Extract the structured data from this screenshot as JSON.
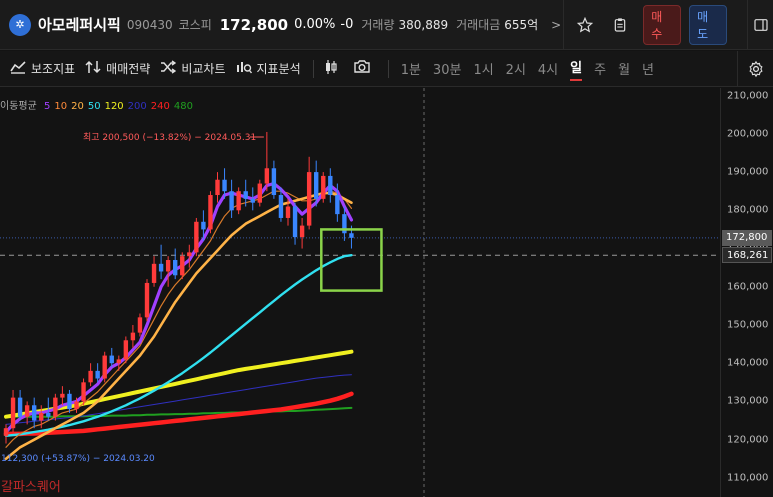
{
  "header": {
    "logo_glyph": "✲",
    "name": "아모레퍼시픽",
    "code": "090430",
    "market": "코스피",
    "price": "172,800",
    "change_pct": "0.00%",
    "change_abs": "-0",
    "volume_label": "거래량",
    "volume": "380,889",
    "amount_label": "거래대금",
    "amount": "655억",
    "nav_arrow": ">",
    "buy_label": "매수",
    "sell_label": "매도"
  },
  "toolbar": {
    "indicators_label": "보조지표",
    "strategy_label": "매매전략",
    "compare_label": "비교차트",
    "analysis_label": "지표분석",
    "periods": [
      "1분",
      "30분",
      "1시",
      "2시",
      "4시",
      "일",
      "주",
      "월",
      "년"
    ],
    "active_period": "일"
  },
  "legend": {
    "title": "이동평균",
    "items": [
      {
        "label": "5",
        "color": "#a040ff"
      },
      {
        "label": "10",
        "color": "#ff8a3a"
      },
      {
        "label": "20",
        "color": "#ffb347"
      },
      {
        "label": "50",
        "color": "#30e0f0"
      },
      {
        "label": "120",
        "color": "#f0f020"
      },
      {
        "label": "200",
        "color": "#3030c0"
      },
      {
        "label": "240",
        "color": "#ff2020"
      },
      {
        "label": "480",
        "color": "#20a020"
      }
    ]
  },
  "annotations": {
    "high": "최고 200,500 (−13.82%) − 2024.05.31",
    "low": "112,300 (+53.87%) − 2024.03.20"
  },
  "watermark": "갈파스퀘어",
  "axis": {
    "ticks": [
      "210,000",
      "200,000",
      "190,000",
      "180,000",
      "170,000",
      "160,000",
      "150,000",
      "140,000",
      "130,000",
      "120,000",
      "110,000"
    ],
    "current_price_tag": "172,800",
    "ma_price_tag": "168,261"
  },
  "colors": {
    "up": "#ff3b3b",
    "down": "#3a86ff",
    "highlight_box": "#8bd44a",
    "ma5": "#a040ff",
    "ma20": "#ffb347",
    "ma50": "#30e0f0",
    "ma120": "#f0f020",
    "ma200": "#3030c0",
    "ma240": "#ff2020",
    "ma480": "#20a020"
  },
  "chart_data": {
    "type": "candlestick",
    "ylim": [
      105000,
      212000
    ],
    "candles": [
      {
        "o": 121000,
        "h": 124000,
        "l": 119000,
        "c": 123000
      },
      {
        "o": 123000,
        "h": 133000,
        "l": 122000,
        "c": 131000
      },
      {
        "o": 131000,
        "h": 133000,
        "l": 125000,
        "c": 126000
      },
      {
        "o": 126000,
        "h": 130000,
        "l": 124000,
        "c": 129000
      },
      {
        "o": 129000,
        "h": 131000,
        "l": 123000,
        "c": 125000
      },
      {
        "o": 125000,
        "h": 129000,
        "l": 123000,
        "c": 127000
      },
      {
        "o": 127000,
        "h": 131000,
        "l": 125000,
        "c": 126000
      },
      {
        "o": 126000,
        "h": 132000,
        "l": 125000,
        "c": 131000
      },
      {
        "o": 131000,
        "h": 134000,
        "l": 129000,
        "c": 132000
      },
      {
        "o": 132000,
        "h": 133000,
        "l": 127000,
        "c": 128000
      },
      {
        "o": 128000,
        "h": 131000,
        "l": 127000,
        "c": 130000
      },
      {
        "o": 130000,
        "h": 136000,
        "l": 129000,
        "c": 135000
      },
      {
        "o": 135000,
        "h": 140000,
        "l": 134000,
        "c": 138000
      },
      {
        "o": 138000,
        "h": 140000,
        "l": 135000,
        "c": 136000
      },
      {
        "o": 136000,
        "h": 143000,
        "l": 135000,
        "c": 142000
      },
      {
        "o": 142000,
        "h": 144000,
        "l": 139000,
        "c": 140000
      },
      {
        "o": 140000,
        "h": 142000,
        "l": 138000,
        "c": 141000
      },
      {
        "o": 141000,
        "h": 147000,
        "l": 140000,
        "c": 146000
      },
      {
        "o": 146000,
        "h": 150000,
        "l": 144000,
        "c": 148000
      },
      {
        "o": 148000,
        "h": 153000,
        "l": 147000,
        "c": 152000
      },
      {
        "o": 152000,
        "h": 162000,
        "l": 151000,
        "c": 161000
      },
      {
        "o": 161000,
        "h": 168000,
        "l": 160000,
        "c": 166000
      },
      {
        "o": 166000,
        "h": 171000,
        "l": 162000,
        "c": 164000
      },
      {
        "o": 164000,
        "h": 168000,
        "l": 160000,
        "c": 167000
      },
      {
        "o": 167000,
        "h": 170000,
        "l": 162000,
        "c": 163000
      },
      {
        "o": 163000,
        "h": 169000,
        "l": 162000,
        "c": 168000
      },
      {
        "o": 168000,
        "h": 171000,
        "l": 165000,
        "c": 169000
      },
      {
        "o": 169000,
        "h": 178000,
        "l": 168000,
        "c": 177000
      },
      {
        "o": 177000,
        "h": 180000,
        "l": 172000,
        "c": 175000
      },
      {
        "o": 175000,
        "h": 185000,
        "l": 174000,
        "c": 184000
      },
      {
        "o": 184000,
        "h": 190000,
        "l": 182000,
        "c": 188000
      },
      {
        "o": 188000,
        "h": 191000,
        "l": 183000,
        "c": 185000
      },
      {
        "o": 185000,
        "h": 188000,
        "l": 178000,
        "c": 180000
      },
      {
        "o": 180000,
        "h": 186000,
        "l": 179000,
        "c": 185000
      },
      {
        "o": 185000,
        "h": 188000,
        "l": 181000,
        "c": 183000
      },
      {
        "o": 183000,
        "h": 186000,
        "l": 180000,
        "c": 182000
      },
      {
        "o": 182000,
        "h": 188000,
        "l": 181000,
        "c": 187000
      },
      {
        "o": 187000,
        "h": 200500,
        "l": 185000,
        "c": 191000
      },
      {
        "o": 191000,
        "h": 193000,
        "l": 183000,
        "c": 184000
      },
      {
        "o": 184000,
        "h": 186000,
        "l": 177000,
        "c": 178000
      },
      {
        "o": 178000,
        "h": 183000,
        "l": 176000,
        "c": 181000
      },
      {
        "o": 181000,
        "h": 182000,
        "l": 171000,
        "c": 173000
      },
      {
        "o": 173000,
        "h": 178000,
        "l": 170000,
        "c": 176000
      },
      {
        "o": 176000,
        "h": 194000,
        "l": 175000,
        "c": 190000
      },
      {
        "o": 190000,
        "h": 193000,
        "l": 181000,
        "c": 183000
      },
      {
        "o": 183000,
        "h": 190000,
        "l": 182000,
        "c": 189000
      },
      {
        "o": 189000,
        "h": 191000,
        "l": 182000,
        "c": 184000
      },
      {
        "o": 184000,
        "h": 187000,
        "l": 177000,
        "c": 179000
      },
      {
        "o": 179000,
        "h": 181000,
        "l": 172000,
        "c": 174000
      },
      {
        "o": 174000,
        "h": 176000,
        "l": 170000,
        "c": 172800
      }
    ],
    "ma_lines": [
      {
        "period": "5",
        "color": "#a040ff",
        "width": 3.2,
        "values": [
          122000,
          124000,
          125500,
          126500,
          127000,
          127000,
          127500,
          128000,
          129000,
          129500,
          130000,
          131500,
          133000,
          134500,
          137000,
          139000,
          140000,
          141500,
          143500,
          145500,
          150000,
          155000,
          160000,
          163000,
          164500,
          165500,
          167000,
          170000,
          172500,
          176000,
          181000,
          184000,
          184500,
          184000,
          183500,
          183000,
          184000,
          186500,
          187000,
          185500,
          183500,
          181000,
          179000,
          180500,
          182000,
          184500,
          186500,
          185000,
          181000,
          177500
        ]
      },
      {
        "period": "20",
        "color": "#ffb347",
        "width": 2.6,
        "values": [
          115000,
          116500,
          118000,
          119000,
          120000,
          121000,
          122000,
          123000,
          124000,
          125000,
          126000,
          127000,
          128500,
          130000,
          132000,
          134000,
          136000,
          138000,
          140000,
          142000,
          144500,
          147000,
          150000,
          153000,
          156000,
          158500,
          161000,
          163500,
          165500,
          167500,
          169500,
          171500,
          173500,
          175000,
          176500,
          177500,
          178500,
          179500,
          180500,
          181500,
          182000,
          182500,
          183000,
          183500,
          184000,
          184500,
          184500,
          184000,
          183000,
          182000
        ]
      },
      {
        "period": "10",
        "color": "#d87a2a",
        "width": 1.2,
        "values": [
          118000,
          120000,
          121500,
          122500,
          123500,
          124000,
          125000,
          126000,
          127000,
          127500,
          128000,
          129500,
          131000,
          132500,
          134500,
          136500,
          138500,
          140500,
          142500,
          144500,
          148000,
          151500,
          155000,
          158000,
          160500,
          162500,
          164500,
          167000,
          169500,
          172000,
          175500,
          178500,
          180500,
          181500,
          182000,
          182500,
          183000,
          184000,
          185000,
          185000,
          184500,
          183500,
          182500,
          182500,
          183000,
          184000,
          185000,
          184500,
          183000,
          180500
        ]
      },
      {
        "period": "50",
        "color": "#30e0f0",
        "width": 2.4,
        "values": [
          121000,
          121200,
          121400,
          121700,
          122000,
          122300,
          122600,
          123000,
          123400,
          123800,
          124300,
          124800,
          125400,
          126000,
          126700,
          127400,
          128200,
          129000,
          129900,
          130800,
          131800,
          132800,
          133900,
          135000,
          136200,
          137400,
          138700,
          140000,
          141400,
          142800,
          144300,
          145800,
          147300,
          148800,
          150300,
          151800,
          153300,
          154800,
          156300,
          157800,
          159200,
          160600,
          161900,
          163100,
          164300,
          165400,
          166400,
          167300,
          168000,
          168261
        ]
      },
      {
        "period": "120",
        "color": "#f0f020",
        "width": 4,
        "values": [
          126000,
          126300,
          126600,
          126900,
          127200,
          127500,
          127800,
          128100,
          128400,
          128700,
          129000,
          129400,
          129800,
          130200,
          130600,
          131000,
          131400,
          131800,
          132200,
          132600,
          133000,
          133400,
          133800,
          134200,
          134600,
          135000,
          135400,
          135800,
          136200,
          136600,
          137000,
          137400,
          137800,
          138200,
          138500,
          138800,
          139100,
          139400,
          139700,
          140000,
          140300,
          140600,
          140900,
          141200,
          141500,
          141800,
          142100,
          142400,
          142700,
          143000
        ]
      },
      {
        "period": "200",
        "color": "#3030c0",
        "width": 1,
        "values": [
          124000,
          124200,
          124400,
          124600,
          124800,
          125000,
          125200,
          125400,
          125600,
          125800,
          126000,
          126200,
          126500,
          126800,
          127100,
          127400,
          127700,
          128000,
          128300,
          128600,
          128900,
          129200,
          129500,
          129800,
          130100,
          130400,
          130700,
          131000,
          131300,
          131600,
          131900,
          132200,
          132500,
          132800,
          133100,
          133400,
          133700,
          134000,
          134300,
          134600,
          134900,
          135200,
          135500,
          135800,
          136100,
          136300,
          136500,
          136700,
          136900,
          137000
        ]
      },
      {
        "period": "240",
        "color": "#ff2020",
        "width": 4.5,
        "values": [
          121500,
          121500,
          121500,
          121600,
          121600,
          121700,
          121800,
          121900,
          122000,
          122100,
          122200,
          122300,
          122500,
          122700,
          122900,
          123100,
          123300,
          123500,
          123700,
          123900,
          124100,
          124300,
          124500,
          124700,
          124900,
          125100,
          125300,
          125500,
          125700,
          125900,
          126100,
          126300,
          126500,
          126700,
          126900,
          127100,
          127300,
          127500,
          127700,
          127900,
          128200,
          128500,
          128800,
          129100,
          129400,
          129800,
          130200,
          130700,
          131300,
          132000
        ]
      },
      {
        "period": "480",
        "color": "#20a020",
        "width": 2,
        "values": [
          126000,
          126000,
          126000,
          126000,
          126000,
          126000,
          126000,
          126000,
          126100,
          126100,
          126100,
          126100,
          126200,
          126200,
          126200,
          126300,
          126300,
          126300,
          126400,
          126400,
          126500,
          126500,
          126600,
          126600,
          126700,
          126700,
          126800,
          126800,
          126900,
          126900,
          127000,
          127000,
          127100,
          127100,
          127200,
          127200,
          127300,
          127300,
          127400,
          127400,
          127500,
          127500,
          127600,
          127700,
          127800,
          127900,
          128000,
          128100,
          128200,
          128300
        ]
      }
    ],
    "current_price": 172800,
    "ma_price": 168261,
    "highlight_box": {
      "from_index": 46,
      "to_index": 49,
      "y_top": 175000,
      "y_bottom": 159000
    }
  }
}
